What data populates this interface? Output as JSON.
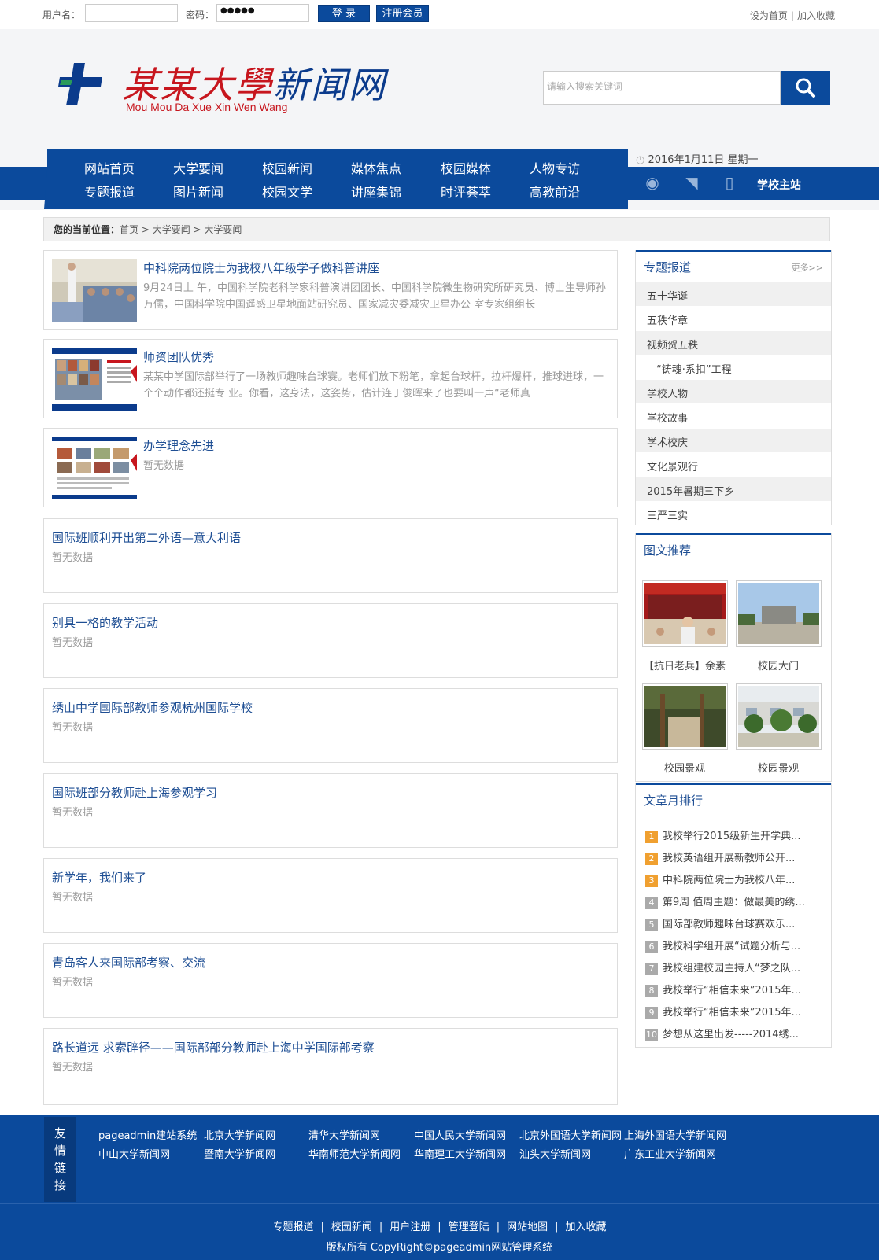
{
  "topbar": {
    "username_label": "用户名：",
    "password_label": "密码：",
    "password_value": "●●●●●",
    "login_label": "登 录",
    "register_label": "注册会员",
    "set_home": "设为首页",
    "separator": "|",
    "add_favorite": "加入收藏"
  },
  "header": {
    "logo_title_red": "某某大學",
    "logo_title_blue": "新闻网",
    "logo_sub": "Mou Mou Da Xue Xin Wen Wang",
    "search_placeholder": "请输入搜索关键词"
  },
  "nav": {
    "row1": [
      "网站首页",
      "大学要闻",
      "校园新闻",
      "媒体焦点",
      "校园媒体",
      "人物专访"
    ],
    "row2": [
      "专题报道",
      "图片新闻",
      "校园文学",
      "讲座集锦",
      "时评荟萃",
      "高教前沿"
    ],
    "date": "2016年1月11日 星期一",
    "school_main": "学校主站"
  },
  "breadcrumb": {
    "label": "您的当前位置：",
    "path": "首页 > 大学要闻 > 大学要闻"
  },
  "news": [
    {
      "title": "中科院两位院士为我校八年级学子做科普讲座",
      "summary": "9月24日上 午，中国科学院老科学家科普演讲团团长、中国科学院微生物研究所研究员、博士生导师孙万儒，中国科学院中国遥感卫星地面站研究员、国家减灾委减灾卫星办公 室专家组组长"
    },
    {
      "title": "师资团队优秀",
      "summary": "某某中学国际部举行了一场教师趣味台球赛。老师们放下粉笔，拿起台球杆，拉杆爆杆，推球进球，一个个动作都还挺专 业。你看，这身法，这姿势，估计连丁俊晖来了也要叫一声“老师真"
    },
    {
      "title": "办学理念先进",
      "summary": "暂无数据"
    },
    {
      "title": "国际班顺利开出第二外语—意大利语",
      "summary": "暂无数据"
    },
    {
      "title": "别具一格的教学活动",
      "summary": "暂无数据"
    },
    {
      "title": "绣山中学国际部教师参观杭州国际学校",
      "summary": "暂无数据"
    },
    {
      "title": "国际班部分教师赴上海参观学习",
      "summary": "暂无数据"
    },
    {
      "title": "新学年，我们来了",
      "summary": "暂无数据"
    },
    {
      "title": "青岛客人来国际部考察、交流",
      "summary": "暂无数据"
    },
    {
      "title": "路长道远 求索辟径——国际部部分教师赴上海中学国际部考察",
      "summary": "暂无数据"
    }
  ],
  "sidebar": {
    "special": {
      "title": "专题报道",
      "more": "更多>>",
      "items": [
        "五十华诞",
        "五秩华章",
        "视频贺五秩",
        "“铸魂·系扣”工程",
        "学校人物",
        "学校故事",
        "学术校庆",
        "文化景观行",
        "2015年暑期三下乡",
        "三严三实"
      ]
    },
    "pictures": {
      "title": "图文推荐",
      "items": [
        "【抗日老兵】余素",
        "校园大门",
        "校园景观",
        "校园景观"
      ]
    },
    "ranking": {
      "title": "文章月排行",
      "items": [
        "我校举行2015级新生开学典...",
        "我校英语组开展新教师公开...",
        "中科院两位院士为我校八年...",
        "第9周 值周主题：做最美的绣...",
        "国际部教师趣味台球赛欢乐...",
        "我校科学组开展“试题分析与...",
        "我校组建校园主持人“梦之队...",
        "我校举行“相信未来”2015年...",
        "我校举行“相信未来”2015年...",
        "梦想从这里出发-----2014绣..."
      ],
      "numbers": [
        "1",
        "2",
        "3",
        "4",
        "5",
        "6",
        "7",
        "8",
        "9",
        "10"
      ]
    }
  },
  "footer": {
    "friend_label": "友情链接",
    "links_row1": [
      "pageadmin建站系统",
      "北京大学新闻网",
      "清华大学新闻网",
      "中国人民大学新闻网",
      "北京外国语大学新闻网",
      "上海外国语大学新闻网"
    ],
    "links_row2": [
      "中山大学新闻网",
      "暨南大学新闻网",
      "华南师范大学新闻网",
      "华南理工大学新闻网",
      "汕头大学新闻网",
      "广东工业大学新闻网"
    ],
    "bottom_links": [
      "专题报道",
      "校园新闻",
      "用户注册",
      "管理登陆",
      "网站地图",
      "加入收藏"
    ],
    "separator": "|",
    "copyright": "版权所有 CopyRight©pageadmin网站管理系统"
  },
  "colors": {
    "primary": "#0b4a9c",
    "accent_red": "#c7161e",
    "rank_top": "#f0a030",
    "rank_other": "#aaaaaa"
  }
}
